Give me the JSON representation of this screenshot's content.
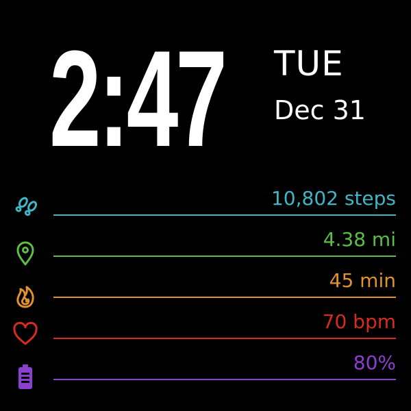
{
  "clock": {
    "time": "2:47",
    "day": "TUE",
    "date": "Dec 31"
  },
  "stats": [
    {
      "name": "steps",
      "icon": "footprints-icon",
      "value": "10,802 steps",
      "color": "#3fb6c6"
    },
    {
      "name": "distance",
      "icon": "location-pin-icon",
      "value": "4.38 mi",
      "color": "#5cbe45"
    },
    {
      "name": "active-minutes",
      "icon": "flame-icon",
      "value": "45 min",
      "color": "#e0922c"
    },
    {
      "name": "heart-rate",
      "icon": "heart-icon",
      "value": "70 bpm",
      "color": "#d62c1f"
    },
    {
      "name": "battery",
      "icon": "battery-icon",
      "value": "80%",
      "color": "#8b3fce"
    }
  ]
}
